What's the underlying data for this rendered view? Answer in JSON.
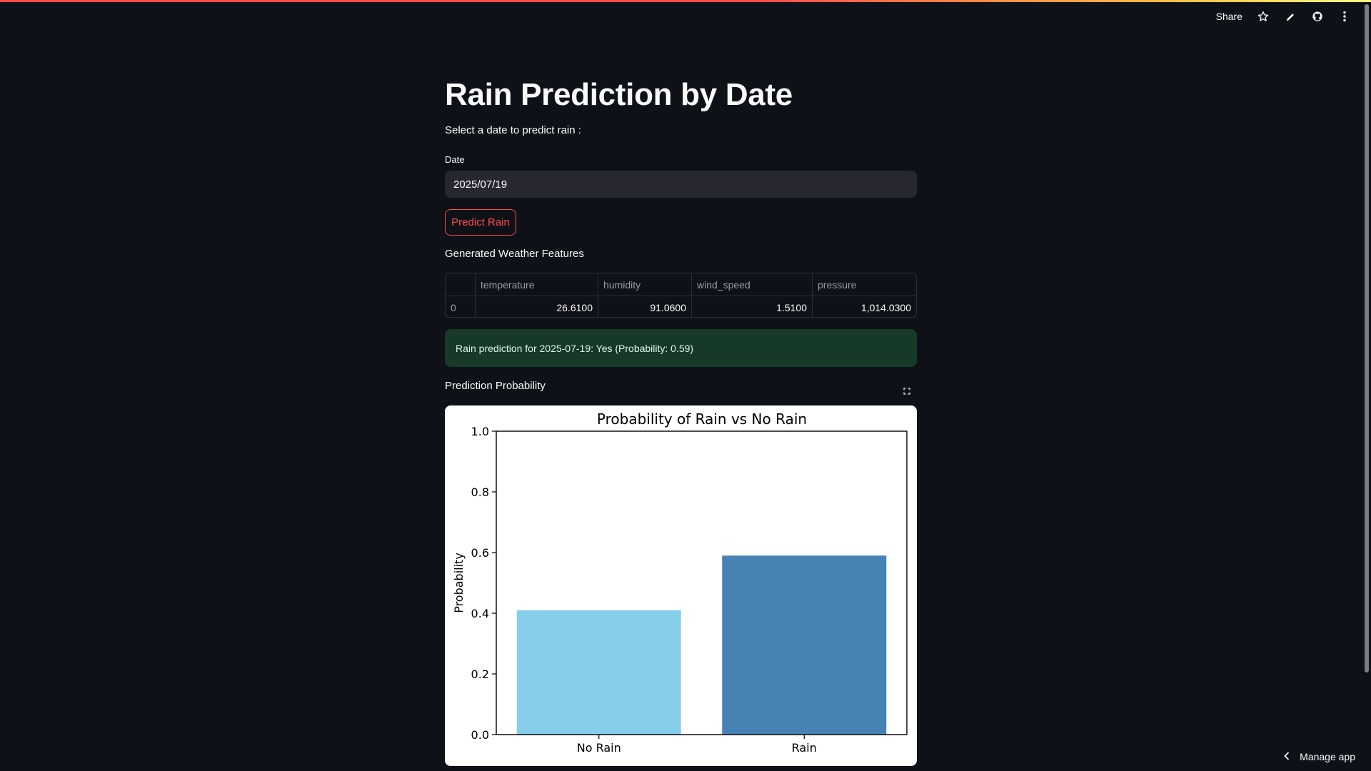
{
  "header": {
    "share_label": "Share"
  },
  "page": {
    "title": "Rain Prediction by Date",
    "subtitle": "Select a date to predict rain :",
    "date_label": "Date",
    "date_value": "2025/07/19",
    "predict_button": "Predict Rain",
    "features_label": "Generated Weather Features",
    "prediction_message": "Rain prediction for 2025-07-19: Yes (Probability: 0.59)",
    "probability_label": "Prediction Probability"
  },
  "table": {
    "columns": [
      "",
      "temperature",
      "humidity",
      "wind_speed",
      "pressure"
    ],
    "rows": [
      [
        "0",
        "26.6100",
        "91.0600",
        "1.5100",
        "1,014.0300"
      ]
    ]
  },
  "chart_data": {
    "type": "bar",
    "title": "Probability of Rain vs No Rain",
    "xlabel": "",
    "ylabel": "Probability",
    "categories": [
      "No Rain",
      "Rain"
    ],
    "values": [
      0.41,
      0.59
    ],
    "colors": [
      "#87ceeb",
      "#4682b4"
    ],
    "ylim": [
      0,
      1.0
    ],
    "yticks": [
      "0.0",
      "0.2",
      "0.4",
      "0.6",
      "0.8",
      "1.0"
    ],
    "grid": false,
    "legend": "none"
  },
  "footer": {
    "manage_label": "Manage app"
  }
}
